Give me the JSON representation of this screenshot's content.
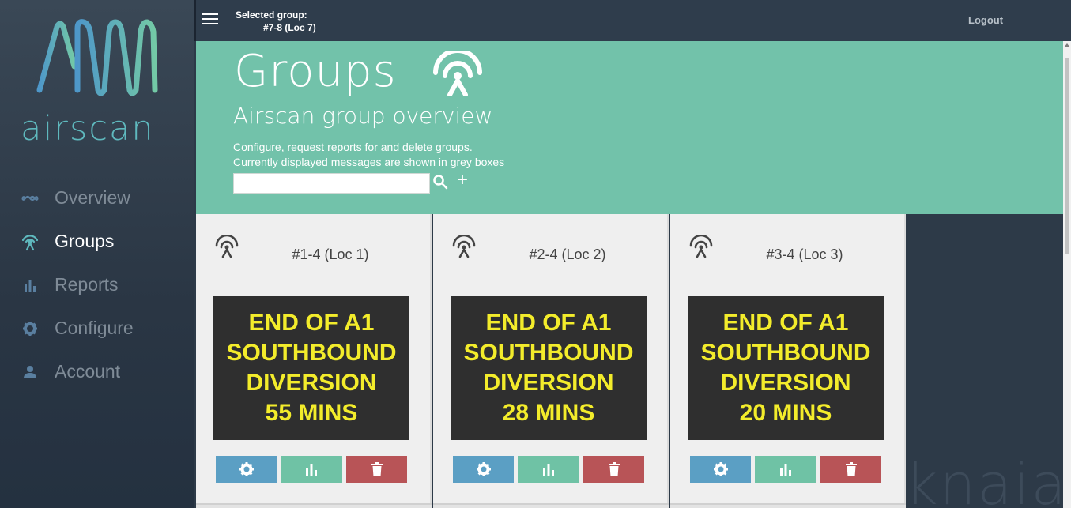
{
  "app": {
    "brand": "airscan",
    "accent": "#72c2aa"
  },
  "sidebar": {
    "items": [
      {
        "label": "Overview",
        "icon": "infinity-icon",
        "active": false
      },
      {
        "label": "Groups",
        "icon": "antenna-icon",
        "active": true
      },
      {
        "label": "Reports",
        "icon": "bar-chart-icon",
        "active": false
      },
      {
        "label": "Configure",
        "icon": "gear-icon",
        "active": false
      },
      {
        "label": "Account",
        "icon": "person-icon",
        "active": false
      }
    ]
  },
  "topbar": {
    "selected_label": "Selected group:",
    "selected_value": "#7-8 (Loc 7)",
    "logout": "Logout"
  },
  "header": {
    "title": "Groups",
    "subtitle": "Airscan group overview",
    "desc_line1": "Configure, request reports for and delete groups.",
    "desc_line2": "Currently displayed messages are shown in grey boxes",
    "search_value": "",
    "search_placeholder": ""
  },
  "groups": [
    {
      "name": "#1-4 (Loc 1)",
      "message": [
        "END OF A1",
        "SOUTHBOUND",
        "DIVERSION",
        "55 MINS"
      ]
    },
    {
      "name": "#2-4 (Loc 2)",
      "message": [
        "END OF A1",
        "SOUTHBOUND",
        "DIVERSION",
        "28 MINS"
      ]
    },
    {
      "name": "#3-4 (Loc 3)",
      "message": [
        "END OF A1",
        "SOUTHBOUND",
        "DIVERSION",
        "20 MINS"
      ]
    }
  ],
  "watermark": "knaia"
}
